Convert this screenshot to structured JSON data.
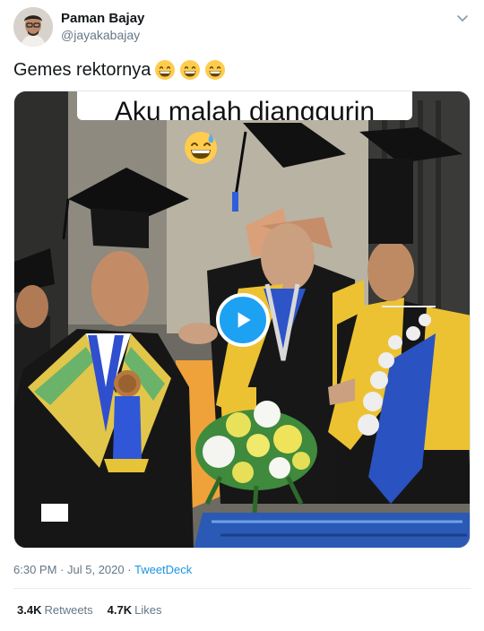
{
  "author": {
    "name": "Paman Bajay",
    "handle": "@jayakabajay"
  },
  "tweet": {
    "text": "Gemes rektornya",
    "emoji_names": [
      "grinning-face-icon",
      "grinning-face-icon",
      "grinning-face-icon"
    ]
  },
  "media": {
    "caption": "Aku malah dianggurin",
    "overlay_emoji": "sweat-smile-icon",
    "play_icon": "play-icon"
  },
  "meta": {
    "time": "6:30 PM",
    "date": "Jul 5, 2020",
    "separator_1": "·",
    "separator_2": "·",
    "source": "TweetDeck"
  },
  "stats": {
    "retweets_count": "3.4K",
    "retweets_label": "Retweets",
    "likes_count": "4.7K",
    "likes_label": "Likes"
  },
  "colors": {
    "link": "#1b95e0",
    "play_button": "#1da1f2",
    "secondary_text": "#657786"
  }
}
